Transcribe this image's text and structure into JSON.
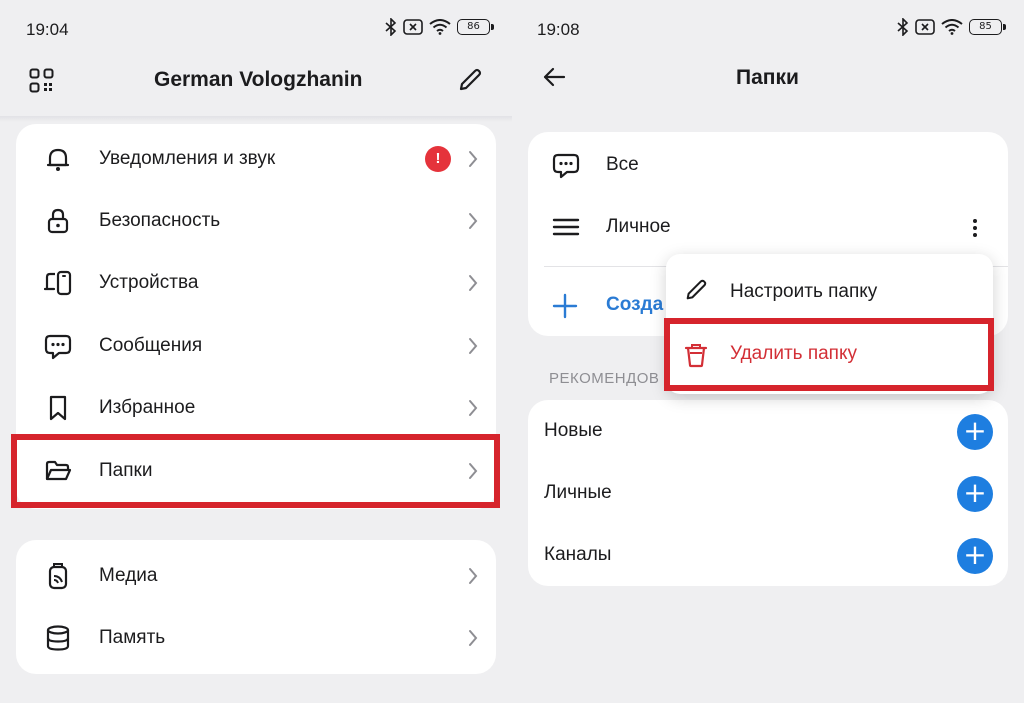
{
  "left": {
    "status": {
      "time": "19:04",
      "battery": "86"
    },
    "header": {
      "title": "German Vologzhanin"
    },
    "settings_card1": [
      {
        "label": "Уведомления и звук",
        "icon": "bell-icon",
        "badge": "!"
      },
      {
        "label": "Безопасность",
        "icon": "lock-icon"
      },
      {
        "label": "Устройства",
        "icon": "devices-icon"
      },
      {
        "label": "Сообщения",
        "icon": "chat-bubble-icon"
      },
      {
        "label": "Избранное",
        "icon": "bookmark-icon"
      },
      {
        "label": "Папки",
        "icon": "folder-icon"
      }
    ],
    "settings_card2": [
      {
        "label": "Медиа",
        "icon": "media-icon"
      },
      {
        "label": "Память",
        "icon": "storage-icon"
      }
    ]
  },
  "right": {
    "status": {
      "time": "19:08",
      "battery": "85"
    },
    "header": {
      "title": "Папки"
    },
    "folders": [
      {
        "label": "Все",
        "icon": "chat-bubble-icon"
      },
      {
        "label": "Личное",
        "icon": "menu-icon"
      }
    ],
    "create_label": "Созда",
    "recommended_header": "РЕКОМЕНДОВ",
    "recommended": [
      {
        "label": "Новые"
      },
      {
        "label": "Личные"
      },
      {
        "label": "Каналы"
      }
    ],
    "popup": {
      "edit_label": "Настроить папку",
      "delete_label": "Удалить папку"
    }
  },
  "colors": {
    "accent": "#1e7ee0",
    "danger": "#d32f36",
    "highlight": "#d6242c",
    "background": "#efeff1"
  }
}
